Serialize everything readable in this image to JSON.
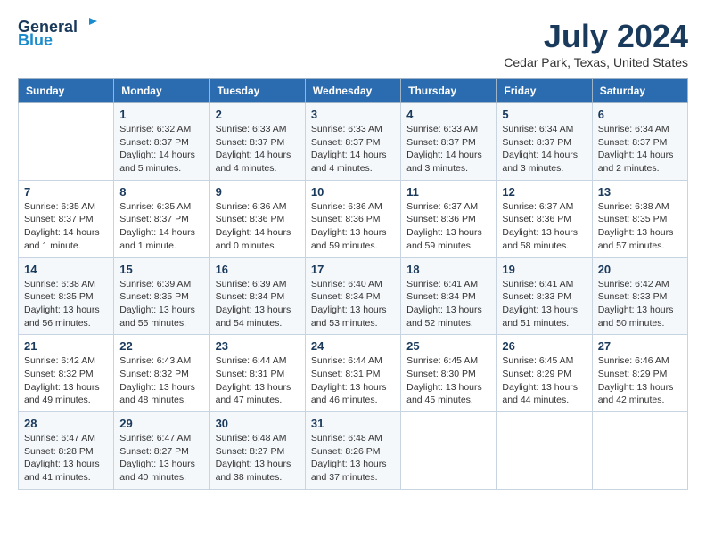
{
  "header": {
    "logo_general": "General",
    "logo_blue": "Blue",
    "month_year": "July 2024",
    "location": "Cedar Park, Texas, United States"
  },
  "calendar": {
    "days_of_week": [
      "Sunday",
      "Monday",
      "Tuesday",
      "Wednesday",
      "Thursday",
      "Friday",
      "Saturday"
    ],
    "weeks": [
      [
        {
          "day": "",
          "info": ""
        },
        {
          "day": "1",
          "info": "Sunrise: 6:32 AM\nSunset: 8:37 PM\nDaylight: 14 hours\nand 5 minutes."
        },
        {
          "day": "2",
          "info": "Sunrise: 6:33 AM\nSunset: 8:37 PM\nDaylight: 14 hours\nand 4 minutes."
        },
        {
          "day": "3",
          "info": "Sunrise: 6:33 AM\nSunset: 8:37 PM\nDaylight: 14 hours\nand 4 minutes."
        },
        {
          "day": "4",
          "info": "Sunrise: 6:33 AM\nSunset: 8:37 PM\nDaylight: 14 hours\nand 3 minutes."
        },
        {
          "day": "5",
          "info": "Sunrise: 6:34 AM\nSunset: 8:37 PM\nDaylight: 14 hours\nand 3 minutes."
        },
        {
          "day": "6",
          "info": "Sunrise: 6:34 AM\nSunset: 8:37 PM\nDaylight: 14 hours\nand 2 minutes."
        }
      ],
      [
        {
          "day": "7",
          "info": "Sunrise: 6:35 AM\nSunset: 8:37 PM\nDaylight: 14 hours\nand 1 minute."
        },
        {
          "day": "8",
          "info": "Sunrise: 6:35 AM\nSunset: 8:37 PM\nDaylight: 14 hours\nand 1 minute."
        },
        {
          "day": "9",
          "info": "Sunrise: 6:36 AM\nSunset: 8:36 PM\nDaylight: 14 hours\nand 0 minutes."
        },
        {
          "day": "10",
          "info": "Sunrise: 6:36 AM\nSunset: 8:36 PM\nDaylight: 13 hours\nand 59 minutes."
        },
        {
          "day": "11",
          "info": "Sunrise: 6:37 AM\nSunset: 8:36 PM\nDaylight: 13 hours\nand 59 minutes."
        },
        {
          "day": "12",
          "info": "Sunrise: 6:37 AM\nSunset: 8:36 PM\nDaylight: 13 hours\nand 58 minutes."
        },
        {
          "day": "13",
          "info": "Sunrise: 6:38 AM\nSunset: 8:35 PM\nDaylight: 13 hours\nand 57 minutes."
        }
      ],
      [
        {
          "day": "14",
          "info": "Sunrise: 6:38 AM\nSunset: 8:35 PM\nDaylight: 13 hours\nand 56 minutes."
        },
        {
          "day": "15",
          "info": "Sunrise: 6:39 AM\nSunset: 8:35 PM\nDaylight: 13 hours\nand 55 minutes."
        },
        {
          "day": "16",
          "info": "Sunrise: 6:39 AM\nSunset: 8:34 PM\nDaylight: 13 hours\nand 54 minutes."
        },
        {
          "day": "17",
          "info": "Sunrise: 6:40 AM\nSunset: 8:34 PM\nDaylight: 13 hours\nand 53 minutes."
        },
        {
          "day": "18",
          "info": "Sunrise: 6:41 AM\nSunset: 8:34 PM\nDaylight: 13 hours\nand 52 minutes."
        },
        {
          "day": "19",
          "info": "Sunrise: 6:41 AM\nSunset: 8:33 PM\nDaylight: 13 hours\nand 51 minutes."
        },
        {
          "day": "20",
          "info": "Sunrise: 6:42 AM\nSunset: 8:33 PM\nDaylight: 13 hours\nand 50 minutes."
        }
      ],
      [
        {
          "day": "21",
          "info": "Sunrise: 6:42 AM\nSunset: 8:32 PM\nDaylight: 13 hours\nand 49 minutes."
        },
        {
          "day": "22",
          "info": "Sunrise: 6:43 AM\nSunset: 8:32 PM\nDaylight: 13 hours\nand 48 minutes."
        },
        {
          "day": "23",
          "info": "Sunrise: 6:44 AM\nSunset: 8:31 PM\nDaylight: 13 hours\nand 47 minutes."
        },
        {
          "day": "24",
          "info": "Sunrise: 6:44 AM\nSunset: 8:31 PM\nDaylight: 13 hours\nand 46 minutes."
        },
        {
          "day": "25",
          "info": "Sunrise: 6:45 AM\nSunset: 8:30 PM\nDaylight: 13 hours\nand 45 minutes."
        },
        {
          "day": "26",
          "info": "Sunrise: 6:45 AM\nSunset: 8:29 PM\nDaylight: 13 hours\nand 44 minutes."
        },
        {
          "day": "27",
          "info": "Sunrise: 6:46 AM\nSunset: 8:29 PM\nDaylight: 13 hours\nand 42 minutes."
        }
      ],
      [
        {
          "day": "28",
          "info": "Sunrise: 6:47 AM\nSunset: 8:28 PM\nDaylight: 13 hours\nand 41 minutes."
        },
        {
          "day": "29",
          "info": "Sunrise: 6:47 AM\nSunset: 8:27 PM\nDaylight: 13 hours\nand 40 minutes."
        },
        {
          "day": "30",
          "info": "Sunrise: 6:48 AM\nSunset: 8:27 PM\nDaylight: 13 hours\nand 38 minutes."
        },
        {
          "day": "31",
          "info": "Sunrise: 6:48 AM\nSunset: 8:26 PM\nDaylight: 13 hours\nand 37 minutes."
        },
        {
          "day": "",
          "info": ""
        },
        {
          "day": "",
          "info": ""
        },
        {
          "day": "",
          "info": ""
        }
      ]
    ]
  }
}
